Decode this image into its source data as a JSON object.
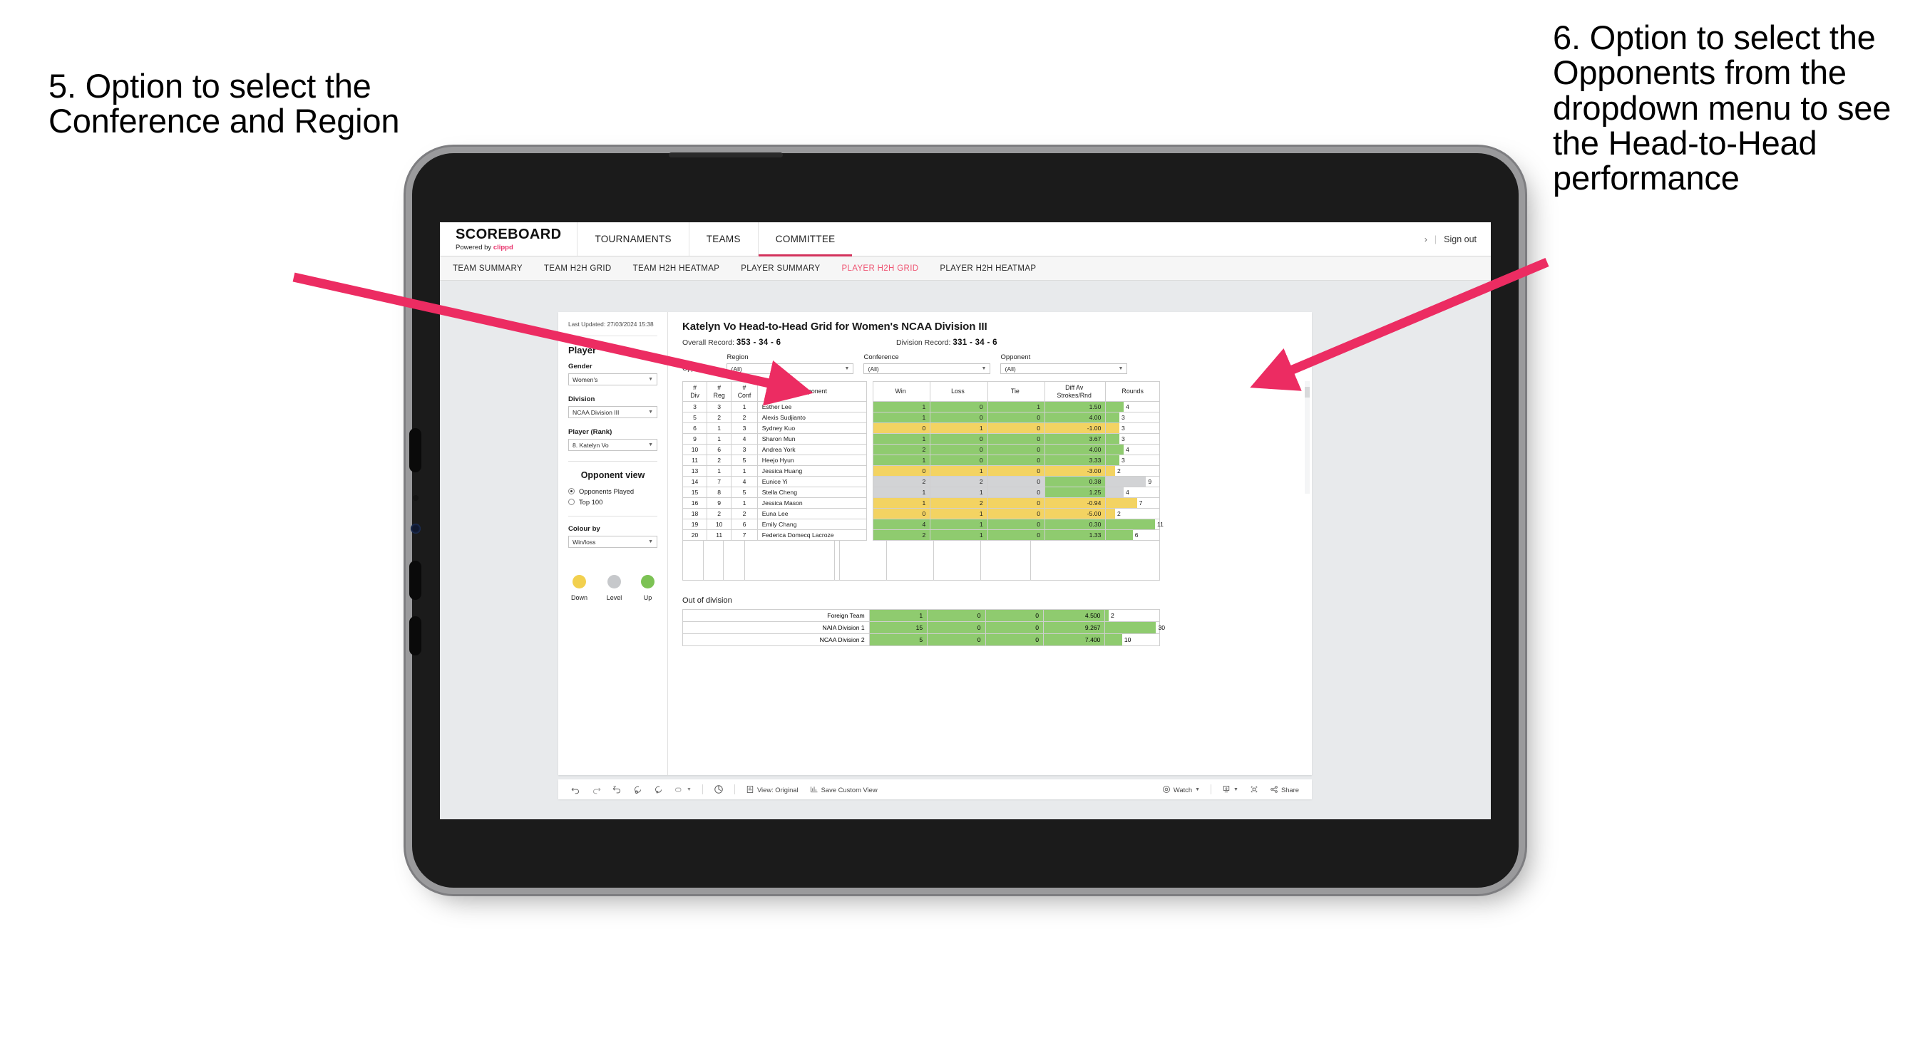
{
  "annotations": {
    "left": "5. Option to select the Conference and Region",
    "right": "6. Option to select the Opponents from the dropdown menu to see the Head-to-Head performance",
    "arrow_color": "#ec2c62"
  },
  "app": {
    "brand": {
      "title": "SCOREBOARD",
      "powered_prefix": "Powered by ",
      "powered_brand": "clippd"
    },
    "nav": [
      {
        "label": "TOURNAMENTS",
        "active": false
      },
      {
        "label": "TEAMS",
        "active": false
      },
      {
        "label": "COMMITTEE",
        "active": true
      }
    ],
    "user": {
      "chevron": "›",
      "divider": "|",
      "sign_out": "Sign out"
    },
    "subnav": [
      {
        "label": "TEAM SUMMARY",
        "active": false
      },
      {
        "label": "TEAM H2H GRID",
        "active": false
      },
      {
        "label": "TEAM H2H HEATMAP",
        "active": false
      },
      {
        "label": "PLAYER SUMMARY",
        "active": false
      },
      {
        "label": "PLAYER H2H GRID",
        "active": true
      },
      {
        "label": "PLAYER H2H HEATMAP",
        "active": false
      }
    ]
  },
  "panel": {
    "last_updated": "Last Updated: 27/03/2024 15:38",
    "player_heading": "Player",
    "gender": {
      "label": "Gender",
      "value": "Women's"
    },
    "division": {
      "label": "Division",
      "value": "NCAA Division III"
    },
    "player_rank": {
      "label": "Player (Rank)",
      "value": "8. Katelyn Vo"
    },
    "opponent_view": {
      "heading": "Opponent view",
      "options": [
        {
          "label": "Opponents Played",
          "selected": true
        },
        {
          "label": "Top 100",
          "selected": false
        }
      ]
    },
    "colour_by": {
      "label": "Colour by",
      "value": "Win/loss"
    },
    "legend": [
      {
        "label": "Down",
        "color": "#f2d04e"
      },
      {
        "label": "Level",
        "color": "#c6c8cb"
      },
      {
        "label": "Up",
        "color": "#7cc254"
      }
    ]
  },
  "main": {
    "title": "Katelyn Vo Head-to-Head Grid for Women's NCAA Division III",
    "overall_record_label": "Overall Record: ",
    "overall_record": "353 - 34 - 6",
    "division_record_label": "Division Record: ",
    "division_record": "331 - 34 - 6",
    "opponents_label": "Opponents:",
    "filters": [
      {
        "label": "Region",
        "value": "(All)"
      },
      {
        "label": "Conference",
        "value": "(All)"
      },
      {
        "label": "Opponent",
        "value": "(All)"
      }
    ]
  },
  "chart_data": {
    "type": "table",
    "title": "Katelyn Vo Head-to-Head Grid for Women's NCAA Division III",
    "columns": [
      "# Div",
      "# Reg",
      "# Conf",
      "Opponent",
      "Win",
      "Loss",
      "Tie",
      "Diff Av Strokes/Rnd",
      "Rounds"
    ],
    "rounds_max": 12,
    "colors": {
      "up": "#8fcb6f",
      "down": "#f3d362",
      "level": "#d2d3d5"
    },
    "rows": [
      {
        "div": "3",
        "reg": "3",
        "conf": "1",
        "opponent": "Esther Lee",
        "win": "1",
        "loss": "0",
        "tie": "1",
        "diff": "1.50",
        "rounds": "4",
        "rounds_n": 4,
        "state": "up"
      },
      {
        "div": "5",
        "reg": "2",
        "conf": "2",
        "opponent": "Alexis Sudjianto",
        "win": "1",
        "loss": "0",
        "tie": "0",
        "diff": "4.00",
        "rounds": "3",
        "rounds_n": 3,
        "state": "up"
      },
      {
        "div": "6",
        "reg": "1",
        "conf": "3",
        "opponent": "Sydney Kuo",
        "win": "0",
        "loss": "1",
        "tie": "0",
        "diff": "-1.00",
        "rounds": "3",
        "rounds_n": 3,
        "state": "down"
      },
      {
        "div": "9",
        "reg": "1",
        "conf": "4",
        "opponent": "Sharon Mun",
        "win": "1",
        "loss": "0",
        "tie": "0",
        "diff": "3.67",
        "rounds": "3",
        "rounds_n": 3,
        "state": "up"
      },
      {
        "div": "10",
        "reg": "6",
        "conf": "3",
        "opponent": "Andrea York",
        "win": "2",
        "loss": "0",
        "tie": "0",
        "diff": "4.00",
        "rounds": "4",
        "rounds_n": 4,
        "state": "up"
      },
      {
        "div": "11",
        "reg": "2",
        "conf": "5",
        "opponent": "Heejo Hyun",
        "win": "1",
        "loss": "0",
        "tie": "0",
        "diff": "3.33",
        "rounds": "3",
        "rounds_n": 3,
        "state": "up"
      },
      {
        "div": "13",
        "reg": "1",
        "conf": "1",
        "opponent": "Jessica Huang",
        "win": "0",
        "loss": "1",
        "tie": "0",
        "diff": "-3.00",
        "rounds": "2",
        "rounds_n": 2,
        "state": "down"
      },
      {
        "div": "14",
        "reg": "7",
        "conf": "4",
        "opponent": "Eunice Yi",
        "win": "2",
        "loss": "2",
        "tie": "0",
        "diff": "0.38",
        "rounds": "9",
        "rounds_n": 9,
        "state": "level",
        "diff_state": "up"
      },
      {
        "div": "15",
        "reg": "8",
        "conf": "5",
        "opponent": "Stella Cheng",
        "win": "1",
        "loss": "1",
        "tie": "0",
        "diff": "1.25",
        "rounds": "4",
        "rounds_n": 4,
        "state": "level",
        "diff_state": "up"
      },
      {
        "div": "16",
        "reg": "9",
        "conf": "1",
        "opponent": "Jessica Mason",
        "win": "1",
        "loss": "2",
        "tie": "0",
        "diff": "-0.94",
        "rounds": "7",
        "rounds_n": 7,
        "state": "down"
      },
      {
        "div": "18",
        "reg": "2",
        "conf": "2",
        "opponent": "Euna Lee",
        "win": "0",
        "loss": "1",
        "tie": "0",
        "diff": "-5.00",
        "rounds": "2",
        "rounds_n": 2,
        "state": "down"
      },
      {
        "div": "19",
        "reg": "10",
        "conf": "6",
        "opponent": "Emily Chang",
        "win": "4",
        "loss": "1",
        "tie": "0",
        "diff": "0.30",
        "rounds": "11",
        "rounds_n": 11,
        "state": "up"
      },
      {
        "div": "20",
        "reg": "11",
        "conf": "7",
        "opponent": "Federica Domecq Lacroze",
        "win": "2",
        "loss": "1",
        "tie": "0",
        "diff": "1.33",
        "rounds": "6",
        "rounds_n": 6,
        "state": "up"
      }
    ],
    "out_of_division": {
      "title": "Out of division",
      "rounds_max": 32,
      "rows": [
        {
          "name": "Foreign Team",
          "win": "1",
          "loss": "0",
          "tie": "0",
          "diff": "4.500",
          "rounds": "2",
          "rounds_n": 2,
          "state": "up"
        },
        {
          "name": "NAIA Division 1",
          "win": "15",
          "loss": "0",
          "tie": "0",
          "diff": "9.267",
          "rounds": "30",
          "rounds_n": 30,
          "state": "up"
        },
        {
          "name": "NCAA Division 2",
          "win": "5",
          "loss": "0",
          "tie": "0",
          "diff": "7.400",
          "rounds": "10",
          "rounds_n": 10,
          "state": "up"
        }
      ]
    }
  },
  "toolbar": {
    "view_label": "View: Original",
    "save_label": "Save Custom View",
    "watch_label": "Watch",
    "share_label": "Share"
  }
}
